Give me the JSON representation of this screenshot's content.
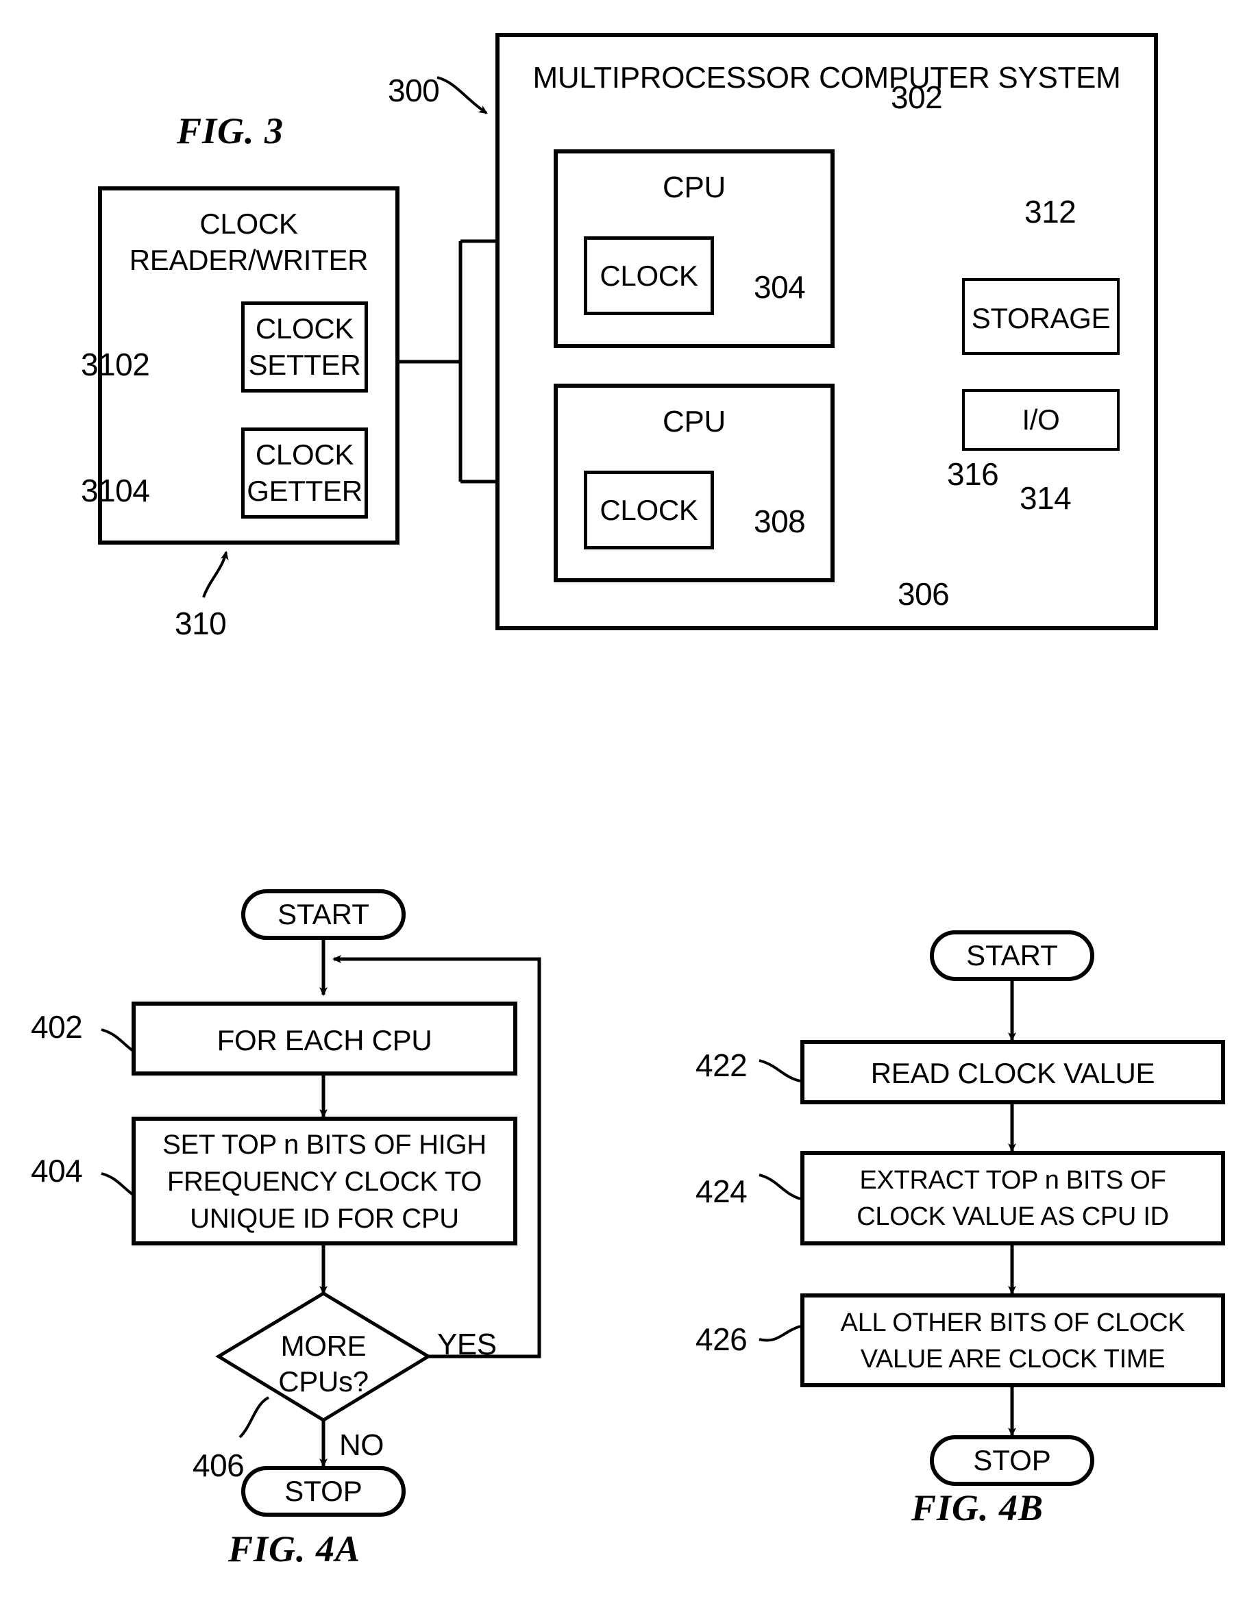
{
  "figures": [
    {
      "id": "fig3",
      "label": "FIG. 3"
    },
    {
      "id": "fig4a",
      "label": "FIG. 4A"
    },
    {
      "id": "fig4b",
      "label": "FIG. 4B"
    }
  ],
  "fig3": {
    "caption": "FIG. 3",
    "system_box": {
      "title": "MULTIPROCESSOR COMPUTER SYSTEM",
      "ref": "300"
    },
    "reader_writer": {
      "title_line1": "CLOCK",
      "title_line2": "READER/WRITER",
      "ref": "310",
      "children": [
        {
          "line1": "CLOCK",
          "line2": "SETTER",
          "ref": "3102"
        },
        {
          "line1": "CLOCK",
          "line2": "GETTER",
          "ref": "3104"
        }
      ]
    },
    "cpus": [
      {
        "title": "CPU",
        "ref": "302",
        "clock_label": "CLOCK",
        "clock_ref": "304"
      },
      {
        "title": "CPU",
        "ref": "306",
        "clock_label": "CLOCK",
        "clock_ref": "308"
      }
    ],
    "peripherals": [
      {
        "label": "STORAGE",
        "ref": "312"
      },
      {
        "label": "I/O",
        "ref": "314"
      }
    ],
    "bus": {
      "ref": "316"
    }
  },
  "fig4a": {
    "caption": "FIG. 4A",
    "start": "START",
    "stop": "STOP",
    "steps": [
      {
        "ref": "402",
        "text": "FOR EACH CPU"
      },
      {
        "ref": "404",
        "text": "SET TOP n BITS OF HIGH FREQUENCY CLOCK TO UNIQUE ID FOR CPU",
        "lines": [
          "SET TOP n BITS OF HIGH",
          "FREQUENCY CLOCK TO",
          "UNIQUE ID FOR CPU"
        ]
      }
    ],
    "decision": {
      "ref": "406",
      "lines": [
        "MORE",
        "CPUs?"
      ],
      "yes_label": "YES",
      "no_label": "NO"
    }
  },
  "fig4b": {
    "caption": "FIG. 4B",
    "start": "START",
    "stop": "STOP",
    "steps": [
      {
        "ref": "422",
        "text": "READ CLOCK VALUE",
        "lines": [
          "READ CLOCK VALUE"
        ]
      },
      {
        "ref": "424",
        "text": "EXTRACT TOP n BITS OF CLOCK VALUE AS CPU ID",
        "lines": [
          "EXTRACT TOP n BITS OF",
          "CLOCK VALUE AS CPU ID"
        ]
      },
      {
        "ref": "426",
        "text": "ALL OTHER BITS OF CLOCK VALUE ARE CLOCK TIME",
        "lines": [
          "ALL OTHER BITS OF CLOCK",
          "VALUE ARE CLOCK TIME"
        ]
      }
    ]
  },
  "colors": {
    "ink": "#000000",
    "paper": "#ffffff"
  }
}
